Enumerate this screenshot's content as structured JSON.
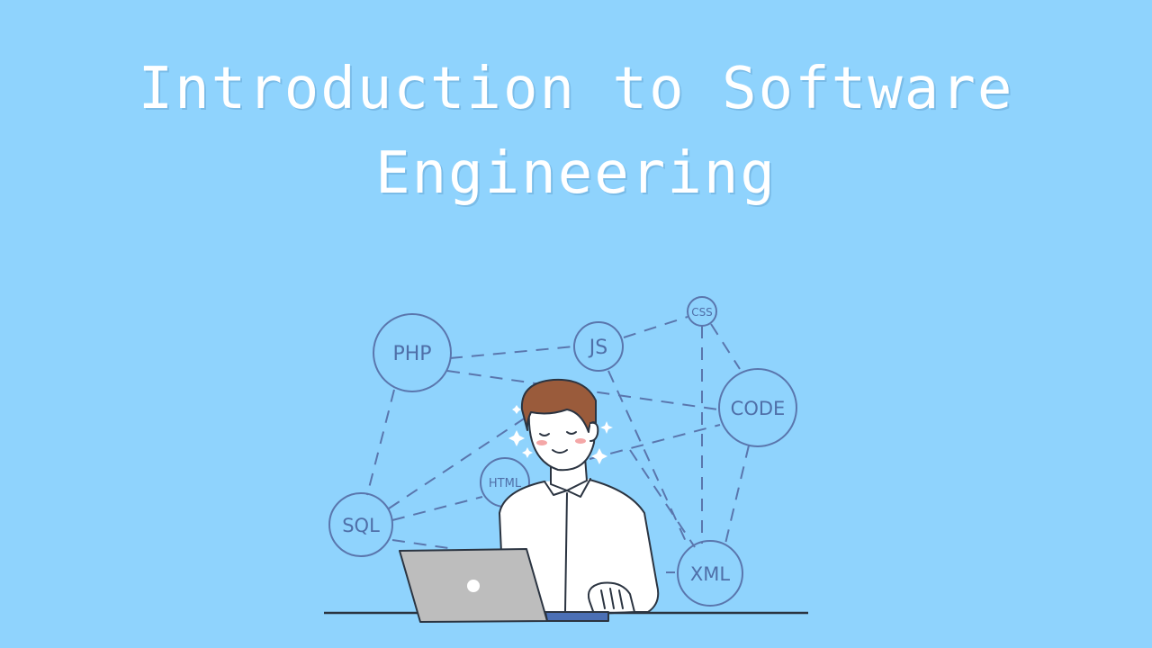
{
  "title": {
    "line1": "Introduction to Software",
    "line2": "Engineering"
  },
  "nodes": {
    "php": "PHP",
    "js": "JS",
    "css": "CSS",
    "code": "CODE",
    "html": "HTML",
    "sql": "SQL",
    "xml": "XML"
  },
  "colors": {
    "background": "#8fd3fd",
    "title": "#ffffff",
    "node_stroke": "#4f6fa8",
    "laptop": "#bdbdbd"
  }
}
